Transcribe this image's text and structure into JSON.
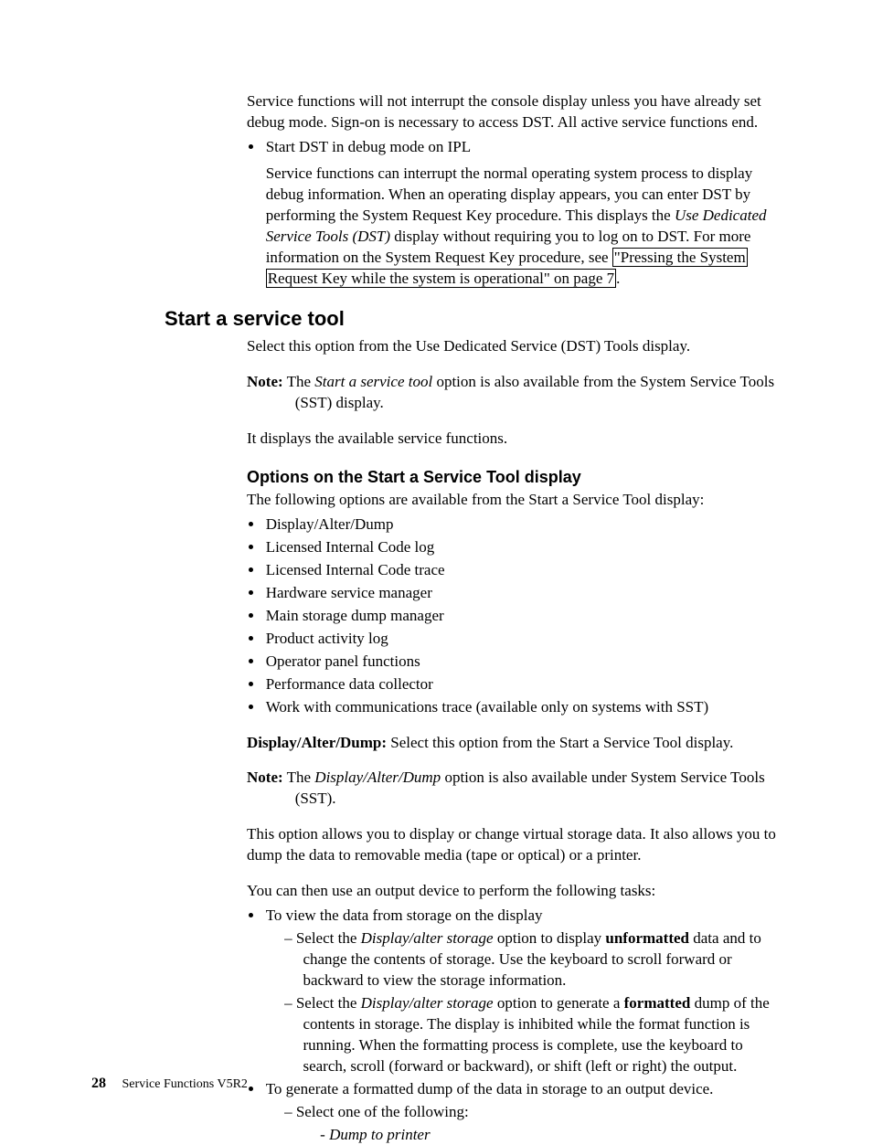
{
  "top": {
    "p1": "Service functions will not interrupt the console display unless you have already set debug mode. Sign-on is necessary to access DST. All active service functions end.",
    "b1": "Start DST in debug mode on IPL",
    "p2a": "Service functions can interrupt the normal operating system process to display debug information. When an operating display appears, you can enter DST by performing the System Request Key procedure. This displays the ",
    "p2i": "Use Dedicated Service Tools (DST)",
    "p2b": " display without requiring you to log on to DST. For more information on the System Request Key procedure, see ",
    "link_a": "\"Pressing the System",
    "link_b": "Request Key while the system is operational\" on page 7",
    "p2c": "."
  },
  "h2": "Start a service tool",
  "sst": {
    "p1": "Select this option from the Use Dedicated Service (DST) Tools display.",
    "note_label": "Note:",
    "note_a": "The ",
    "note_i": "Start a service tool",
    "note_b": " option is also available from the System Service Tools (SST) display.",
    "p2": "It displays the available service functions."
  },
  "h3": "Options on the Start a Service Tool display",
  "opts": {
    "intro": "The following options are available from the Start a Service Tool display:",
    "items": [
      "Display/Alter/Dump",
      "Licensed Internal Code log",
      "Licensed Internal Code trace",
      "Hardware service manager",
      "Main storage dump manager",
      "Product activity log",
      "Operator panel functions",
      "Performance data collector",
      "Work with communications trace (available only on systems with SST)"
    ]
  },
  "dad": {
    "runin": "Display/Alter/Dump:",
    "p1": "  Select this option from the Start a Service Tool display.",
    "note_label": "Note:",
    "note_a": "The ",
    "note_i": "Display/Alter/Dump",
    "note_b": " option is also available under System Service Tools (SST).",
    "p2": "This option allows you to display or change virtual storage data. It also allows you to dump the data to removable media (tape or optical) or a printer.",
    "p3": "You can then use an output device to perform the following tasks:",
    "bul1": "To view the data from storage on the display",
    "d1a": "Select the ",
    "d1i": "Display/alter storage",
    "d1b": " option to display ",
    "d1bold": "unformatted",
    "d1c": " data and to change the contents of storage. Use the keyboard to scroll forward or backward to view the storage information.",
    "d2a": "Select the ",
    "d2i": "Display/alter storage",
    "d2b": " option to generate a ",
    "d2bold": "formatted",
    "d2c": " dump of the contents in storage. The display is inhibited while the format function is running. When the formatting process is complete, use the keyboard to search, scroll (forward or backward), or shift (left or right) the output.",
    "bul2": "To generate a formatted dump of the data in storage to an output device.",
    "d3": "Select one of the following:",
    "h1": "Dump to printer"
  },
  "footer": {
    "page": "28",
    "title": "Service Functions V5R2"
  }
}
